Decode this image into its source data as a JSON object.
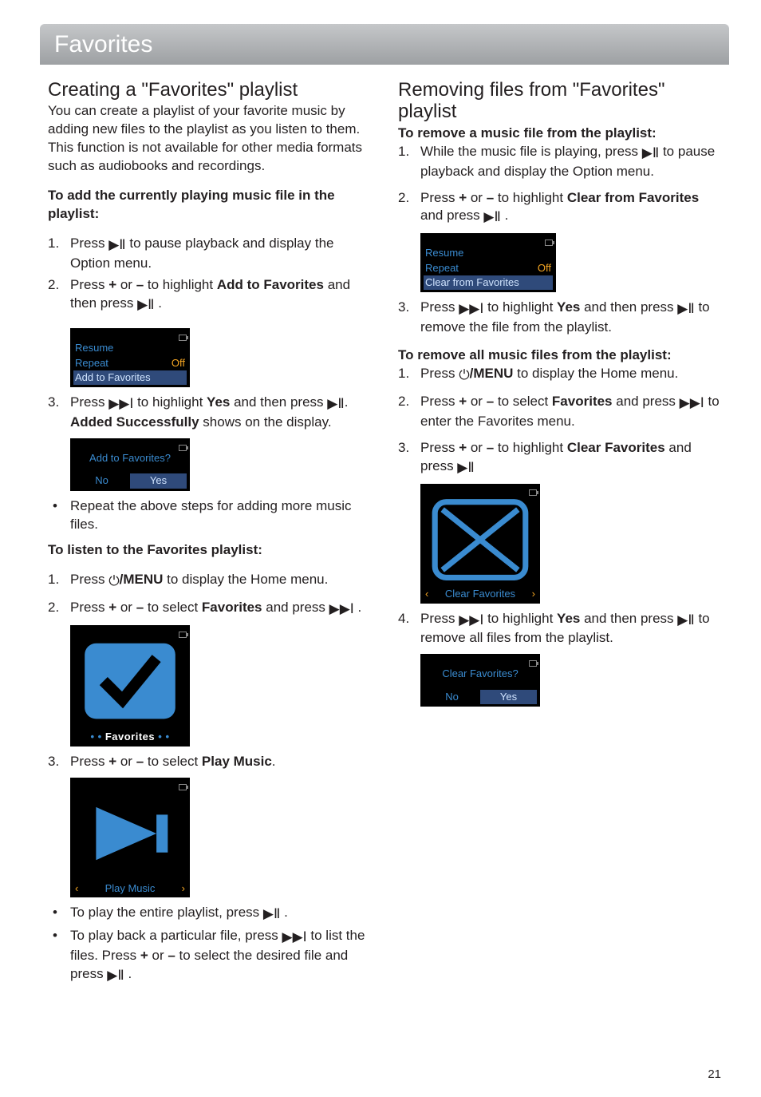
{
  "page_title": "Favorites",
  "page_number": "21",
  "left": {
    "h2": "Creating a \"Favorites\" playlist",
    "intro": "You can create a playlist of your favorite music by adding new files to the playlist as you listen to them. This function is not available for other media formats such as audiobooks and recordings.",
    "add_heading": "To add the currently playing music file in the playlist:",
    "step1a": "Press ",
    "step1b": " to pause playback and display the Option menu.",
    "step2a": "Press ",
    "step2plus": "+",
    "step2or": " or ",
    "step2minus": "–",
    "step2b": " to highlight ",
    "step2bold": "Add to Favorites",
    "step2c": " and then press ",
    "step2d": " .",
    "scr1_resume": "Resume",
    "scr1_repeat": "Repeat",
    "scr1_off": "Off",
    "scr1_add": "Add to Favorites",
    "step3a": "Press ",
    "step3b": " to highlight ",
    "step3yes": "Yes",
    "step3c": " and then press ",
    "step3d": ". ",
    "step3bold2": "Added Successfully",
    "step3e": " shows on the display.",
    "scr2_q": "Add to Favorites?",
    "scr_no": "No",
    "scr_yes": "Yes",
    "bullet_repeat": "Repeat the above steps for adding more music files.",
    "listen_heading": "To listen to the Favorites playlist:",
    "listen1a": "Press ",
    "listen1menu": "/MENU",
    "listen1b": " to display the Home menu.",
    "listen2a": "Press ",
    "listen2plus": "+",
    "listen2or": " or ",
    "listen2minus": "–",
    "listen2b": " to select ",
    "listen2fav": "Favorites",
    "listen2c": " and press ",
    "listen2d": " .",
    "scr3_fav": "Favorites",
    "listen3a": "Press ",
    "listen3plus": "+",
    "listen3or": " or ",
    "listen3minus": "–",
    "listen3b": " to select ",
    "listen3play": "Play Music",
    "listen3c": ".",
    "scr4_play": "Play Music",
    "bul_a1": "To play the entire playlist, press ",
    "bul_a2": " .",
    "bul_b1": "To play back a particular file, press ",
    "bul_b2": " to list the files. Press ",
    "bul_b_plus": "+",
    "bul_b_or": " or ",
    "bul_b_minus": "–",
    "bul_b3": " to select the desired file and press ",
    "bul_b4": " ."
  },
  "right": {
    "h2": "Removing files from \"Favorites\" playlist",
    "remove_heading": "To remove a music file from the playlist:",
    "r1a": "While the music file is playing, press ",
    "r1b": " to pause playback and display the Option menu.",
    "r2a": "Press ",
    "r2plus": "+",
    "r2or": " or ",
    "r2minus": "–",
    "r2b": " to highlight ",
    "r2bold": "Clear from Favorites",
    "r2c": " and press ",
    "r2d": " .",
    "scrR1_resume": "Resume",
    "scrR1_repeat": "Repeat",
    "scrR1_off": "Off",
    "scrR1_clear": "Clear from Favorites",
    "r3a": "Press ",
    "r3b": " to highlight ",
    "r3yes": "Yes",
    "r3c": " and then press ",
    "r3d": " to remove the file from the playlist.",
    "removeall_heading": "To remove all music files from the playlist:",
    "ra1a": "Press ",
    "ra1menu": "/MENU",
    "ra1b": " to display the Home menu.",
    "ra2a": "Press ",
    "ra2plus": "+",
    "ra2or": " or ",
    "ra2minus": "–",
    "ra2b": " to select ",
    "ra2fav": "Favorites",
    "ra2c": " and press ",
    "ra2d": " to enter the Favorites menu.",
    "ra3a": "Press ",
    "ra3plus": "+",
    "ra3or": " or ",
    "ra3minus": "–",
    "ra3b": " to highlight ",
    "ra3bold": "Clear Favorites",
    "ra3c": " and press ",
    "scrR2_clear": "Clear Favorites",
    "ra4a": "Press ",
    "ra4b": " to highlight ",
    "ra4yes": "Yes",
    "ra4c": " and then press ",
    "ra4d": " to remove all files from the playlist.",
    "scrR3_q": "Clear Favorites?",
    "scrR3_no": "No",
    "scrR3_yes": "Yes"
  }
}
